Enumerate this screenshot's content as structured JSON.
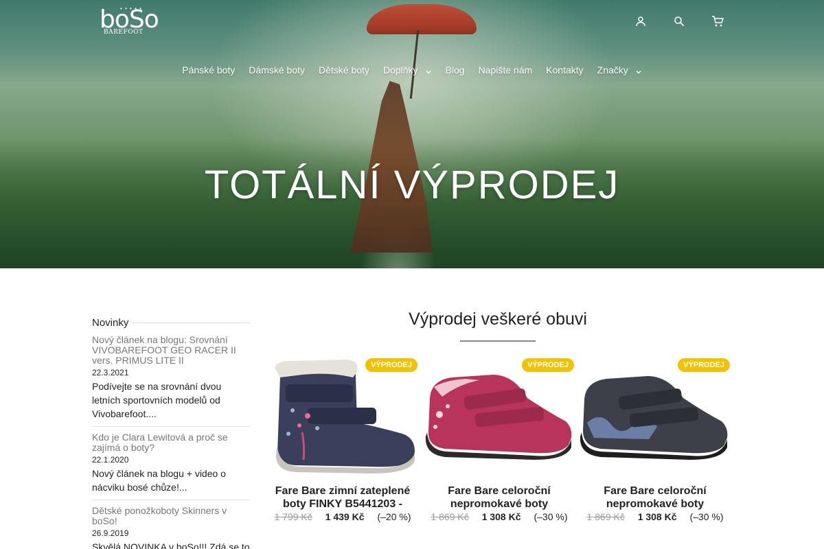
{
  "logo": {
    "text": "boSo",
    "sub": "BAREFOOT"
  },
  "header_icons": [
    "user-icon",
    "search-icon",
    "cart-icon"
  ],
  "nav": [
    {
      "label": "Pánské boty",
      "has_submenu": false
    },
    {
      "label": "Dámské boty",
      "has_submenu": false
    },
    {
      "label": "Dětské boty",
      "has_submenu": false
    },
    {
      "label": "Doplňky",
      "has_submenu": true
    },
    {
      "label": "Blog",
      "has_submenu": false
    },
    {
      "label": "Napište nám",
      "has_submenu": false
    },
    {
      "label": "Kontakty",
      "has_submenu": false
    },
    {
      "label": "Značky",
      "has_submenu": true
    }
  ],
  "hero": {
    "title": "TOTÁLNÍ VÝPRODEJ"
  },
  "sidebar": {
    "heading": "Novinky",
    "items": [
      {
        "title": "Nový článek na blogu: Srovnání VIVOBAREFOOT GEO RACER II vers. PRIMUS LITE II",
        "date": "22.3.2021",
        "text": "Podívejte se na srovnání dvou letních sportovních modelů od Vivobarefoot...."
      },
      {
        "title": "Kdo je Clara Lewitová a proč se zajímá o boty?",
        "date": "22.1.2020",
        "text": "Nový článek na blogu + video o nácviku bosé chůze!..."
      },
      {
        "title": "Dětské ponožkoboty Skinners v boSo!",
        "date": "26.9.2019",
        "text": "Skvělá NOVINKA v boSo!!! Zdá se to"
      }
    ]
  },
  "main": {
    "title": "Výprodej veškeré obuvi",
    "products": [
      {
        "badge": "VÝPRODEJ",
        "name": "Fare Bare zimní zateplené boty FINKY B5441203 -",
        "old_price": "1 799 Kč",
        "price": "1 439 Kč",
        "discount": "(–20 %)",
        "color": "#3a3f5c"
      },
      {
        "badge": "VÝPRODEJ",
        "name": "Fare Bare celoroční nepromokavé boty",
        "old_price": "1 869 Kč",
        "price": "1 308 Kč",
        "discount": "(–30 %)",
        "color": "#b8345a"
      },
      {
        "badge": "VÝPRODEJ",
        "name": "Fare Bare celoroční nepromokavé boty",
        "old_price": "1 869 Kč",
        "price": "1 308 Kč",
        "discount": "(–30 %)",
        "color": "#3d4048"
      }
    ]
  },
  "colors": {
    "badge": "#f2c200",
    "hero_text": "#ffffff",
    "text": "#222222",
    "muted": "#777777"
  }
}
